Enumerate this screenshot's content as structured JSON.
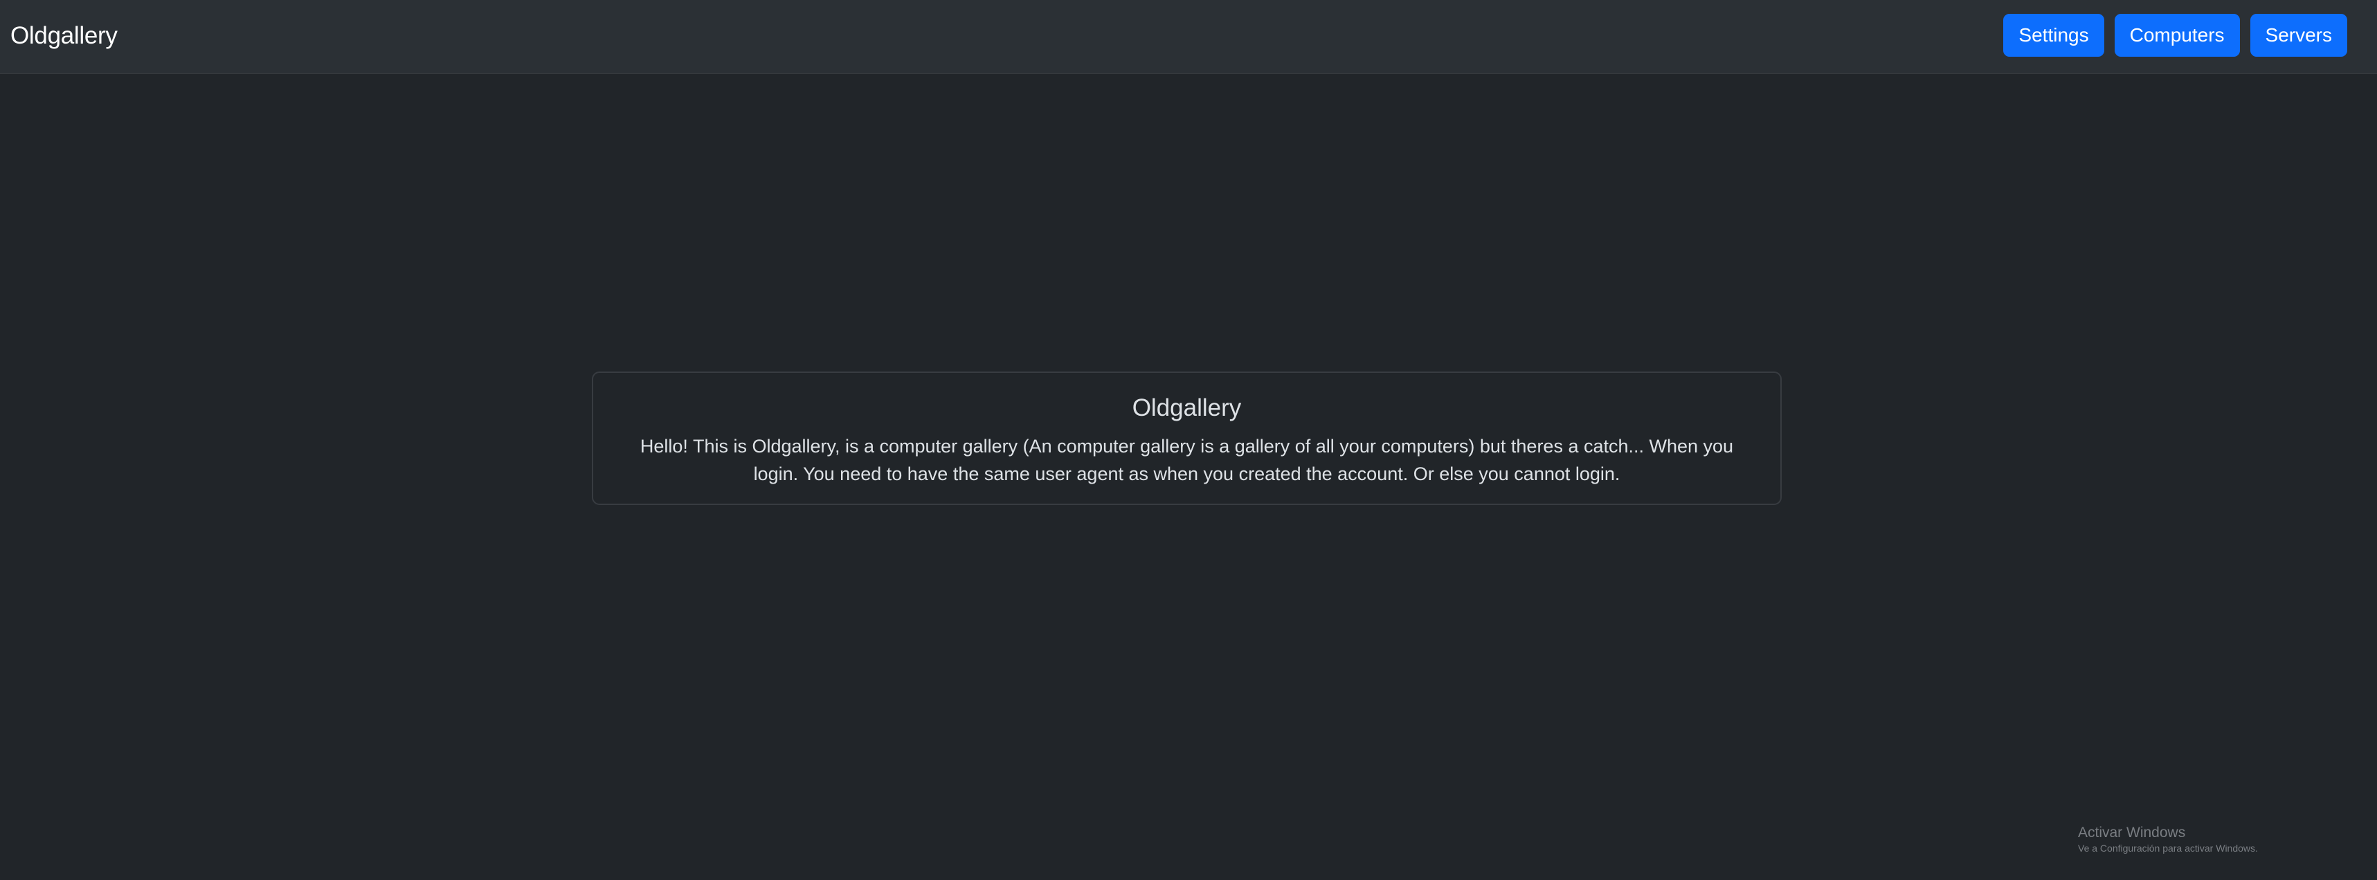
{
  "navbar": {
    "brand": "Oldgallery",
    "buttons": [
      {
        "label": "Settings"
      },
      {
        "label": "Computers"
      },
      {
        "label": "Servers"
      }
    ],
    "button_color": "#0d6efd"
  },
  "card": {
    "title": "Oldgallery",
    "text": "Hello! This is Oldgallery, is a computer gallery (An computer gallery is a gallery of all your computers) but theres a catch... When you login. You need to have the same user agent as when you created the account. Or else you cannot login."
  },
  "watermark": {
    "title": "Activar Windows",
    "subtitle": "Ve a Configuración para activar Windows."
  },
  "colors": {
    "background": "#212529",
    "navbar": "#2b3035",
    "accent": "#0d6efd"
  }
}
